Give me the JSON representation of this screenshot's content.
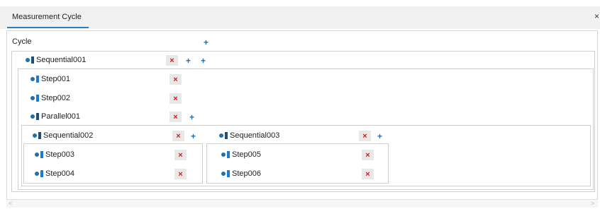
{
  "tab": {
    "label": "Measurement Cycle",
    "close": "×"
  },
  "root": {
    "label": "Cycle",
    "add": "+"
  },
  "buttons": {
    "remove": "×",
    "add": "+"
  },
  "nodes": {
    "seq001": "Sequential001",
    "step001": "Step001",
    "step002": "Step002",
    "par001": "Parallel001",
    "seq002": "Sequential002",
    "seq003": "Sequential003",
    "step003": "Step003",
    "step004": "Step004",
    "step005": "Step005",
    "step006": "Step006"
  },
  "scroll": {
    "left": "<",
    "right": ">"
  },
  "colors": {
    "accent": "#2a7fc0",
    "remove": "#d21b1b",
    "add": "#1f6fb2"
  }
}
